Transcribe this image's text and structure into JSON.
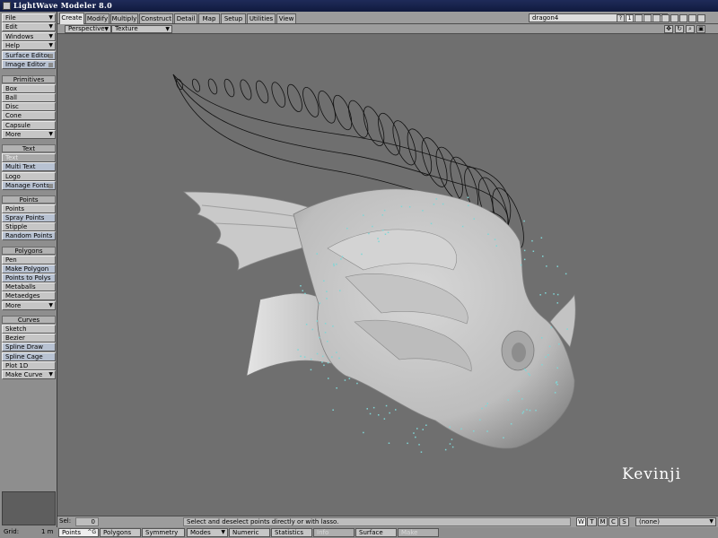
{
  "window": {
    "title": "LightWave Modeler 8.0"
  },
  "sidebar": {
    "top_menus": [
      {
        "label": "File",
        "dropdown": true
      },
      {
        "label": "Edit",
        "dropdown": true
      },
      {
        "label": "Windows",
        "dropdown": true
      },
      {
        "label": "Help",
        "dropdown": true
      },
      {
        "label": "Surface Editor",
        "dropdown": false
      },
      {
        "label": "Image Editor",
        "dropdown": false
      }
    ],
    "groups": [
      {
        "header": "Primitives",
        "items": [
          {
            "label": "Box"
          },
          {
            "label": "Ball"
          },
          {
            "label": "Disc"
          },
          {
            "label": "Cone"
          },
          {
            "label": "Capsule"
          },
          {
            "label": "More",
            "dropdown": true
          }
        ]
      },
      {
        "header": "Text",
        "items": [
          {
            "label": "Text",
            "disabled": true
          },
          {
            "label": "Multi Text"
          },
          {
            "label": "Logo"
          },
          {
            "label": "Manage Fonts"
          }
        ]
      },
      {
        "header": "Points",
        "items": [
          {
            "label": "Points"
          },
          {
            "label": "Spray Points"
          },
          {
            "label": "Stipple"
          },
          {
            "label": "Random Points"
          }
        ]
      },
      {
        "header": "Polygons",
        "items": [
          {
            "label": "Pen"
          },
          {
            "label": "Make Polygon"
          },
          {
            "label": "Points to Polys"
          },
          {
            "label": "Metaballs"
          },
          {
            "label": "Metaedges"
          },
          {
            "label": "More",
            "dropdown": true
          }
        ]
      },
      {
        "header": "Curves",
        "items": [
          {
            "label": "Sketch"
          },
          {
            "label": "Bezier"
          },
          {
            "label": "Spline Draw"
          },
          {
            "label": "Spline Cage"
          },
          {
            "label": "Plot 1D"
          },
          {
            "label": "Make Curve",
            "dropdown": true
          }
        ]
      }
    ]
  },
  "tabs": [
    "Create",
    "Modify",
    "Multiply",
    "Construct",
    "Detail",
    "Map",
    "Setup",
    "Utilities",
    "View"
  ],
  "active_tab": "Create",
  "object_selector": {
    "value": "dragon4"
  },
  "toolbar_icons": [
    "layer-number-icon",
    "layout-1-icon",
    "layout-2-icon",
    "layout-3-icon",
    "layout-4-icon",
    "layout-5-icon",
    "layout-6-icon",
    "layout-7-icon",
    "layout-8-icon",
    "layout-9-icon"
  ],
  "view_header": {
    "view_type": "Perspective",
    "render_mode": "Texture"
  },
  "watermark": "Kevinji",
  "status": {
    "sel_label": "Sel:",
    "sel_value": "0",
    "message": "Select and deselect points directly or with lasso.",
    "layer_buttons": [
      "W",
      "T",
      "M",
      "C",
      "S"
    ],
    "surface": "(none)"
  },
  "bottom_bar": {
    "grid_label": "Grid:",
    "grid_value": "1 m",
    "buttons": [
      {
        "label": "Points",
        "shortcut": "^G",
        "active": true
      },
      {
        "label": "Polygons",
        "shortcut": "",
        "active": false
      },
      {
        "label": "Symmetry",
        "shortcut": "",
        "active": false
      },
      {
        "label": "Modes",
        "dropdown": true
      },
      {
        "label": "Numeric"
      },
      {
        "label": "Statistics"
      },
      {
        "label": "Info",
        "disabled": true
      },
      {
        "label": "Surface"
      },
      {
        "label": "Make",
        "disabled": true
      }
    ]
  },
  "colors": {
    "viewport_bg": "#6f6f6f",
    "mesh_fill": "#c8c8c8",
    "wire": "#111111",
    "vertex": "#7fd6d6",
    "title_bg": "#16214a"
  }
}
